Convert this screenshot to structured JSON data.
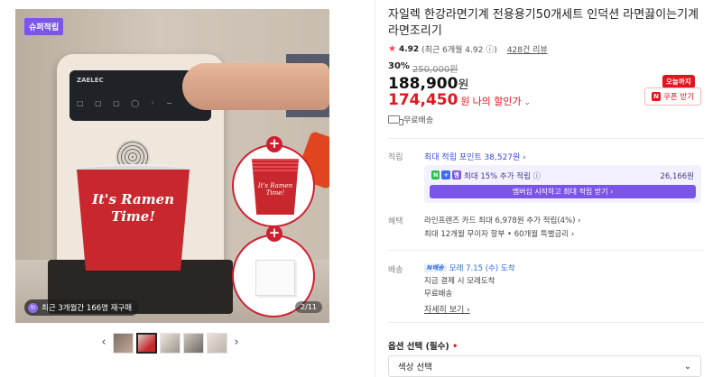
{
  "gallery": {
    "badge": "슈퍼적립",
    "machine_brand": "ZAELEC",
    "cup_text": "It's Ramen Time!",
    "zoom_cup_text": "It's Ramen Time!",
    "reorder_text": "최근 3개월간 166명 재구매",
    "page_indicator": "2/11",
    "prev_arrow": "‹",
    "next_arrow": "›"
  },
  "product": {
    "title": "자일렉 한강라면기계 전용용기50개세트 인덕션 라면끓이는기계 라면조리기",
    "rating": {
      "score": "4.92",
      "recent": "(최근 6개월 4.92",
      "review_count": "428건 리뷰"
    },
    "discount_rate": "30%",
    "list_price": "250,000원",
    "price": "188,900",
    "price_unit": "원",
    "my_price": "174,450",
    "my_price_unit": "원",
    "my_price_label": "나의 할인가",
    "coupon": {
      "tag": "오늘까지",
      "label": "쿠폰 받기"
    },
    "shipping_note": "무료배송"
  },
  "points": {
    "section_label": "적립",
    "max_points": "최대 적립 포인트 38,527원 ›",
    "tags": [
      "N",
      "+",
      "멤"
    ],
    "rate_text": "최대 15% 추가 적립",
    "amount": "26,166원",
    "membership_button": "멤버십 시작하고 최대 적립 받기 ›"
  },
  "benefits": {
    "section_label": "혜택",
    "line1": "라인프렌즈 카드 최대 6,978원 추가 적립(4%) ›",
    "line2": "최대 12개월 무이자 할부 • 60개월 특별금리 ›"
  },
  "delivery": {
    "section_label": "배송",
    "fast_badge": "N배송",
    "arrival": "모레 7.15 (수) 도착",
    "note": "지금 결제 시 모레도착",
    "fee": "무료배송",
    "detail_link": "자세히 보기 ›"
  },
  "options": {
    "title": "옵션 선택 (필수)",
    "required_mark": "•",
    "select_label": "색상 선택",
    "select_chevron": "⌄"
  },
  "colors": {
    "accent_red": "#e4141e",
    "purple": "#7a55e8",
    "link_blue": "#3b4bd8"
  }
}
